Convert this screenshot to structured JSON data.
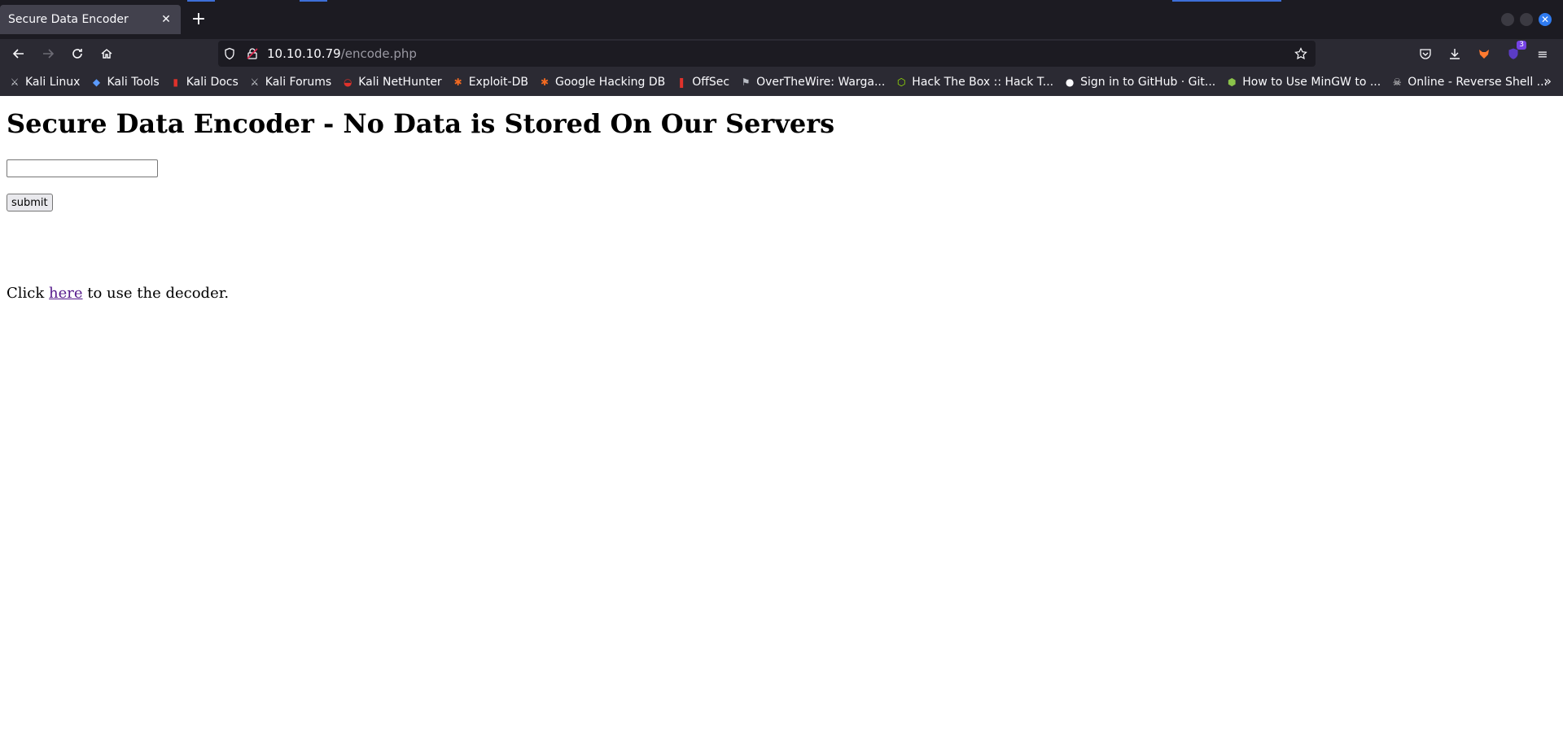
{
  "browser": {
    "tab": {
      "title": "Secure Data Encoder"
    },
    "url": {
      "host": "10.10.10.79",
      "path": "/encode.php"
    },
    "extensions_badge": "3",
    "bookmarks": [
      {
        "label": "Kali Linux",
        "icon": "kali-dragon-icon"
      },
      {
        "label": "Kali Tools",
        "icon": "kali-tools-icon"
      },
      {
        "label": "Kali Docs",
        "icon": "kali-docs-icon"
      },
      {
        "label": "Kali Forums",
        "icon": "kali-dragon-icon"
      },
      {
        "label": "Kali NetHunter",
        "icon": "nethunter-icon"
      },
      {
        "label": "Exploit-DB",
        "icon": "exploitdb-icon"
      },
      {
        "label": "Google Hacking DB",
        "icon": "exploitdb-icon"
      },
      {
        "label": "OffSec",
        "icon": "offsec-icon"
      },
      {
        "label": "OverTheWire: Warga...",
        "icon": "overthewire-icon"
      },
      {
        "label": "Hack The Box :: Hack T...",
        "icon": "hackthebox-icon"
      },
      {
        "label": "Sign in to GitHub · Git...",
        "icon": "github-icon"
      },
      {
        "label": "How to Use MinGW to ...",
        "icon": "mingw-icon"
      },
      {
        "label": "Online - Reverse Shell ...",
        "icon": "skull-icon"
      }
    ]
  },
  "page": {
    "heading": "Secure Data Encoder - No Data is Stored On Our Servers",
    "input_value": "",
    "submit_label": "submit",
    "decoder_prefix": "Click",
    "decoder_link": "here",
    "decoder_suffix": "to use the decoder."
  },
  "colors": {
    "chrome_bg": "#1c1b22",
    "toolbar_bg": "#2b2a33",
    "link_visited": "#551a8b",
    "accent": "#2f7bf0"
  }
}
